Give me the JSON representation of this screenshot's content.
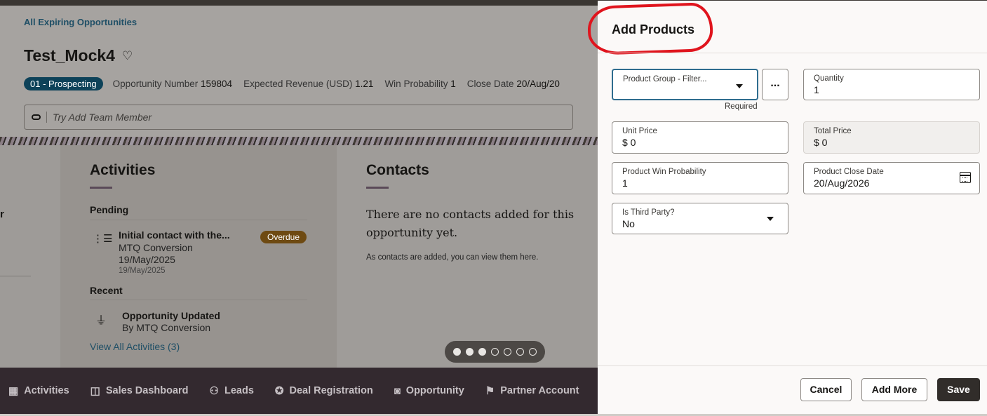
{
  "breadcrumb": "All Expiring Opportunities",
  "opportunity": {
    "title": "Test_Mock4",
    "stage": "01 - Prospecting",
    "number_label": "Opportunity Number",
    "number_value": "159804",
    "revenue_label": "Expected Revenue (USD)",
    "revenue_value": "1.21",
    "win_label": "Win Probability",
    "win_value": "1",
    "close_label": "Close Date",
    "close_value": "20/Aug/20"
  },
  "team_member": {
    "placeholder": "Try Add Team Member"
  },
  "left_fragment": "r",
  "activities": {
    "title": "Activities",
    "pending_label": "Pending",
    "pending_item": {
      "title": "Initial contact with the...",
      "owner": "MTQ Conversion",
      "date": "19/May/2025",
      "date_small": "19/May/2025",
      "badge": "Overdue"
    },
    "recent_label": "Recent",
    "recent_item": {
      "title": "Opportunity Updated",
      "by": "By MTQ Conversion"
    },
    "view_all": "View All Activities (3)"
  },
  "contacts": {
    "title": "Contacts",
    "empty_message": "There are no contacts added for this opportunity yet.",
    "empty_sub": "As contacts are added, you can view them here."
  },
  "pager": {
    "total": 7,
    "active": 3
  },
  "bottom_nav": [
    {
      "label": "Activities",
      "icon": "calendar-icon",
      "glyph": "▦"
    },
    {
      "label": "Sales Dashboard",
      "icon": "dashboard-icon",
      "glyph": "◫"
    },
    {
      "label": "Leads",
      "icon": "leads-icon",
      "glyph": "⚇"
    },
    {
      "label": "Deal Registration",
      "icon": "deal-registration-icon",
      "glyph": "✪"
    },
    {
      "label": "Opportunity",
      "icon": "opportunity-icon",
      "glyph": "◙"
    },
    {
      "label": "Partner Account",
      "icon": "partner-account-icon",
      "glyph": "⚑"
    }
  ],
  "drawer": {
    "title": "Add Products",
    "product_group": {
      "label": "Product Group - Filter...",
      "required": "Required"
    },
    "more_label": "...",
    "quantity": {
      "label": "Quantity",
      "value": "1"
    },
    "unit_price": {
      "label": "Unit Price",
      "value": "$ 0"
    },
    "total_price": {
      "label": "Total Price",
      "value": "$ 0"
    },
    "win_probability": {
      "label": "Product Win Probability",
      "value": "1"
    },
    "close_date": {
      "label": "Product Close Date",
      "value": "20/Aug/2026"
    },
    "third_party": {
      "label": "Is Third Party?",
      "value": "No"
    },
    "buttons": {
      "cancel": "Cancel",
      "add_more": "Add More",
      "save": "Save"
    }
  },
  "colors": {
    "stage_badge": "#0d4259",
    "overdue_badge": "#6e4a12",
    "annotation": "#e0141d",
    "save_button": "#312d2a"
  }
}
